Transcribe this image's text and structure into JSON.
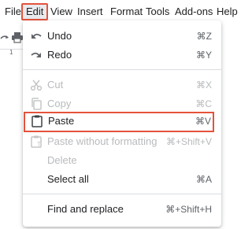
{
  "menubar": {
    "items": [
      "File",
      "Edit",
      "View",
      "Insert",
      "Format",
      "Tools",
      "Add-ons",
      "Help"
    ]
  },
  "ruler": {
    "mark": "1"
  },
  "edit_menu": {
    "undo": {
      "label": "Undo",
      "shortcut": "⌘Z",
      "icon": "undo-icon"
    },
    "redo": {
      "label": "Redo",
      "shortcut": "⌘Y",
      "icon": "redo-icon"
    },
    "cut": {
      "label": "Cut",
      "shortcut": "⌘X",
      "icon": "scissors-icon"
    },
    "copy": {
      "label": "Copy",
      "shortcut": "⌘C",
      "icon": "copy-icon"
    },
    "paste": {
      "label": "Paste",
      "shortcut": "⌘V",
      "icon": "clipboard-icon"
    },
    "paste_plain": {
      "label": "Paste without formatting",
      "shortcut": "⌘+Shift+V",
      "icon": "clipboard-text-icon"
    },
    "delete": {
      "label": "Delete"
    },
    "select_all": {
      "label": "Select all",
      "shortcut": "⌘A"
    },
    "find_replace": {
      "label": "Find and replace",
      "shortcut": "⌘+Shift+H"
    }
  },
  "colors": {
    "highlight_outline": "#e4523b",
    "active_menu_bg": "#e8eaed",
    "disabled_text": "#b8babd",
    "text": "#202124"
  }
}
